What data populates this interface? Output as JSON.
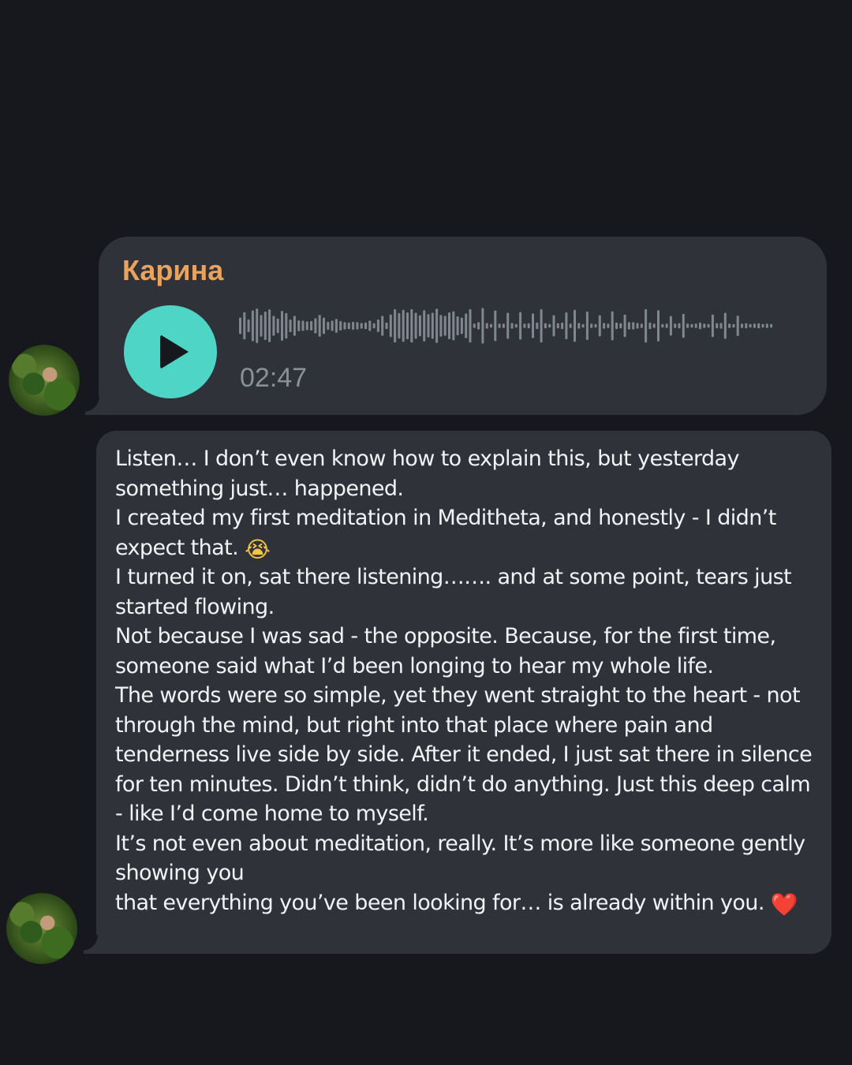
{
  "conversation": {
    "voice_message": {
      "sender": "Карина",
      "duration": "02:47",
      "waveform_levels": [
        0.45,
        0.75,
        0.35,
        0.85,
        0.95,
        0.6,
        0.78,
        0.9,
        0.55,
        0.4,
        0.82,
        0.7,
        0.35,
        0.55,
        0.3,
        0.28,
        0.24,
        0.26,
        0.42,
        0.6,
        0.45,
        0.22,
        0.28,
        0.38,
        0.26,
        0.2,
        0.18,
        0.22,
        0.2,
        0.16,
        0.18,
        0.28,
        0.14,
        0.35,
        0.55,
        0.18,
        0.62,
        0.92,
        0.7,
        0.88,
        0.74,
        0.92,
        0.72,
        0.58,
        0.86,
        0.64,
        0.72,
        0.94,
        0.6,
        0.55,
        0.74,
        0.8,
        0.52,
        0.45,
        0.68,
        0.92,
        0.12,
        0.2,
        0.98,
        0.16,
        0.1,
        0.84,
        0.12,
        0.12,
        0.72,
        0.16,
        0.1,
        0.76,
        0.12,
        0.14,
        0.68,
        0.18,
        0.92,
        0.14,
        0.1,
        0.58,
        0.14,
        0.18,
        0.74,
        0.12,
        0.88,
        0.16,
        0.1,
        0.78,
        0.12,
        0.1,
        0.58,
        0.16,
        0.12,
        0.8,
        0.18,
        0.14,
        0.62,
        0.2,
        0.2,
        0.16,
        0.12,
        0.92,
        0.18,
        0.12,
        0.86,
        0.1,
        0.12,
        0.54,
        0.12,
        0.14,
        0.66,
        0.12,
        0.1,
        0.12,
        0.18,
        0.12,
        0.1,
        0.62,
        0.14,
        0.16,
        0.72,
        0.12,
        0.1,
        0.56,
        0.12,
        0.14,
        0.1,
        0.12,
        0.14,
        0.1,
        0.12,
        0.1
      ],
      "colors": {
        "sender": "#e9a35f",
        "play_button": "#4fd5c6",
        "waveform": "#7f8790"
      }
    },
    "text_message": {
      "paragraphs": [
        "Listen… I don’t even know how to explain this, but yesterday something just… happened.",
        "I created my first meditation in Meditheta, and honestly - I didn’t expect that.",
        "I turned it on, sat there listening……. and at some point, tears just started flowing.",
        "Not because I was sad - the opposite. Because, for the first time, someone said what I’d been longing to hear my whole life.",
        "The words were so simple, yet they went straight to the heart - not through the mind, but right into that place where pain and tenderness live side by side. After it ended, I just sat there in silence for ten minutes. Didn’t think, didn’t do anything. Just this deep calm - like I’d come home to myself.",
        "It’s not even about meditation, really. It’s more like someone gently showing you",
        "that everything you’ve been looking for… is already within you."
      ],
      "emoji_after_paragraph_2": "😭",
      "emoji_after_paragraph_7": "❤️"
    },
    "icons": {
      "play": "play-icon",
      "avatar": "avatar"
    }
  }
}
